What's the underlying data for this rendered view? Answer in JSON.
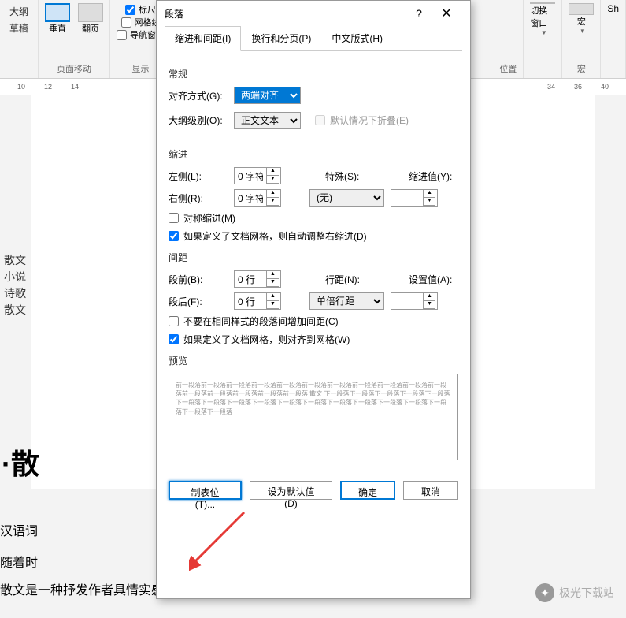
{
  "ribbon": {
    "outline": "大纲",
    "draft": "草稿",
    "vertical": "垂直",
    "flip": "翻页",
    "pagemove_label": "页面移动",
    "ruler": "标尺",
    "gridlines": "网格线",
    "navpane": "导航窗格",
    "display_label": "显示",
    "switch_window": "切换窗口",
    "macro": "宏",
    "sh": "Sh",
    "position": "位置"
  },
  "ruler_marks": [
    "10",
    "12",
    "14",
    "34",
    "36",
    "40"
  ],
  "dialog": {
    "title": "段落",
    "help": "?",
    "close": "✕",
    "tabs": {
      "indent_spacing": "缩进和间距(I)",
      "line_page": "换行和分页(P)",
      "chinese": "中文版式(H)"
    },
    "sections": {
      "general": "常规",
      "indent": "缩进",
      "spacing": "间距",
      "preview": "预览"
    },
    "labels": {
      "alignment": "对齐方式(G):",
      "outline_level": "大纲级别(O):",
      "left": "左侧(L):",
      "right": "右侧(R):",
      "special": "特殊(S):",
      "indent_value": "缩进值(Y):",
      "before": "段前(B):",
      "after": "段后(F):",
      "line_spacing": "行距(N):",
      "set_value": "设置值(A):",
      "mirror_indent": "对称缩进(M)",
      "auto_adjust_right": "如果定义了文档网格，则自动调整右缩进(D)",
      "no_same_style": "不要在相同样式的段落间增加间距(C)",
      "snap_grid": "如果定义了文档网格，则对齐到网格(W)",
      "collapse": "默认情况下折叠(E)"
    },
    "values": {
      "alignment": "两端对齐",
      "outline_level": "正文文本",
      "left": "0 字符",
      "right": "0 字符",
      "special": "(无)",
      "before": "0 行",
      "after": "0 行",
      "line_spacing": "单倍行距"
    },
    "preview_text": "前一段落前一段落前一段落前一段落前一段落前一段落前一段落前一段落前一段落前一段落前一段落前一段落前一段落前一段落前一段落前一段落 散文 下一段落下一段落下一段落下一段落下一段落下一段落下一段落下一段落下一段落下一段落下一段落下一段落下一段落下一段落下一段落下一段落下一段落下一段落",
    "buttons": {
      "tabs": "制表位(T)...",
      "default": "设为默认值(D)",
      "ok": "确定",
      "cancel": "取消"
    }
  },
  "document": {
    "sidebar_items": [
      "散文",
      "小说",
      "诗歌",
      "散文"
    ],
    "heading": "·散",
    "body1": "汉语词",
    "body2": "随着时",
    "body3": "散文是一种抒发作者具情实感、写作方式灵活的记叙类文"
  },
  "watermark": "极光下载站"
}
